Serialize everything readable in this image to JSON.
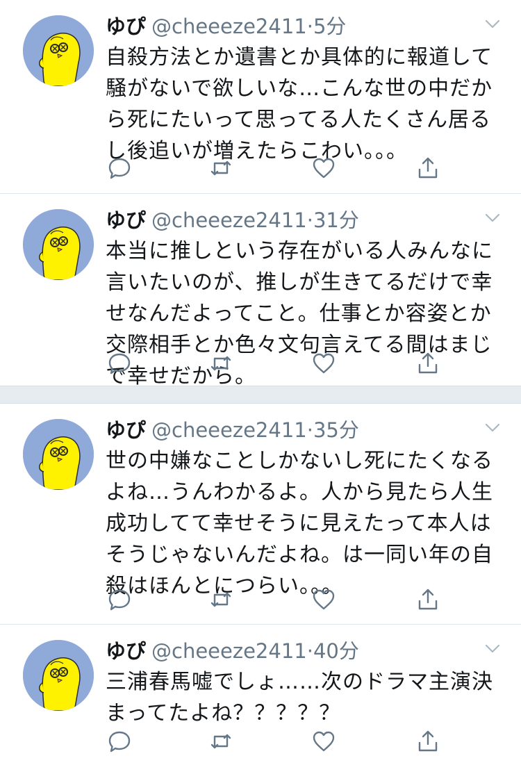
{
  "tweets": [
    {
      "name": "ゆぴ",
      "handle": "@cheeeze2411",
      "separator": "·",
      "time": "5分",
      "text": "自殺方法とか遺書とか具体的に報道して騒がないで欲しいな…こんな世の中だから死にたいって思ってる人たくさん居るし後追いが増えたらこわい。。。"
    },
    {
      "name": "ゆぴ",
      "handle": "@cheeeze2411",
      "separator": "·",
      "time": "31分",
      "text": "本当に推しという存在がいる人みんなに言いたいのが、推しが生きてるだけで幸せなんだよってこと。仕事とか容姿とか交際相手とか色々文句言えてる間はまじで幸せだから。"
    },
    {
      "name": "ゆぴ",
      "handle": "@cheeeze2411",
      "separator": "·",
      "time": "35分",
      "text": "世の中嫌なことしかないし死にたくなるよね…うんわかるよ。人から見たら人生成功してて幸せそうに見えたって本人はそうじゃないんだよね。は一同い年の自殺はほんとにつらい。。。"
    },
    {
      "name": "ゆぴ",
      "handle": "@cheeeze2411",
      "separator": "·",
      "time": "40分",
      "text": "三浦春馬嘘でしょ……次のドラマ主演決まってたよね？？？？？"
    }
  ],
  "icons": {
    "reply": "reply-icon",
    "retweet": "retweet-icon",
    "like": "heart-icon",
    "share": "share-icon",
    "caret": "chevron-down-icon",
    "avatar": "yellow-chick-avatar"
  },
  "colors": {
    "text": "#14171a",
    "secondary": "#657786",
    "divider": "#e1e8ed",
    "gap": "#e6ecf0",
    "avatar_bg": "#8fa9d9",
    "chick": "#fff200"
  }
}
